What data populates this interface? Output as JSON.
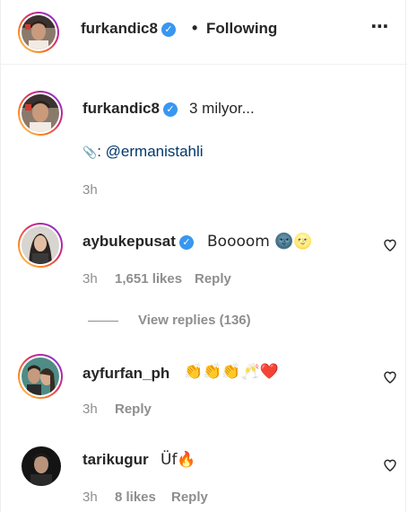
{
  "header": {
    "username": "furkandic8",
    "verified_mark": "✓",
    "separator": "•",
    "follow_status": "Following",
    "more_icon": "⋯"
  },
  "caption": {
    "username": "furkandic8",
    "verified_mark": "✓",
    "text": "3 milyor...",
    "credit_icon": "📎",
    "credit_prefix": ":",
    "credit_mention": "@ermanistahli",
    "time": "3h"
  },
  "comments": [
    {
      "username": "aybukepusat",
      "verified": true,
      "text": "Boooom 🌚🌝",
      "time": "3h",
      "likes": "1,651 likes",
      "reply_label": "Reply"
    },
    {
      "username": "ayfurfan_ph",
      "verified": false,
      "text": "👏👏👏🥂❤️",
      "time": "3h",
      "likes": "",
      "reply_label": "Reply"
    },
    {
      "username": "tarikugur",
      "verified": false,
      "text": "Üf🔥",
      "time": "3h",
      "likes": "8 likes",
      "reply_label": "Reply"
    }
  ],
  "view_replies": "View replies (136)",
  "icons": {
    "more": "more-horizontal-icon",
    "heart": "heart-outline-icon",
    "verified": "verified-badge-icon",
    "credit": "paperclip-icon"
  },
  "colors": {
    "verified": "#3897f0",
    "mention": "#00376b",
    "muted": "#8e8e8e",
    "text": "#262626"
  }
}
